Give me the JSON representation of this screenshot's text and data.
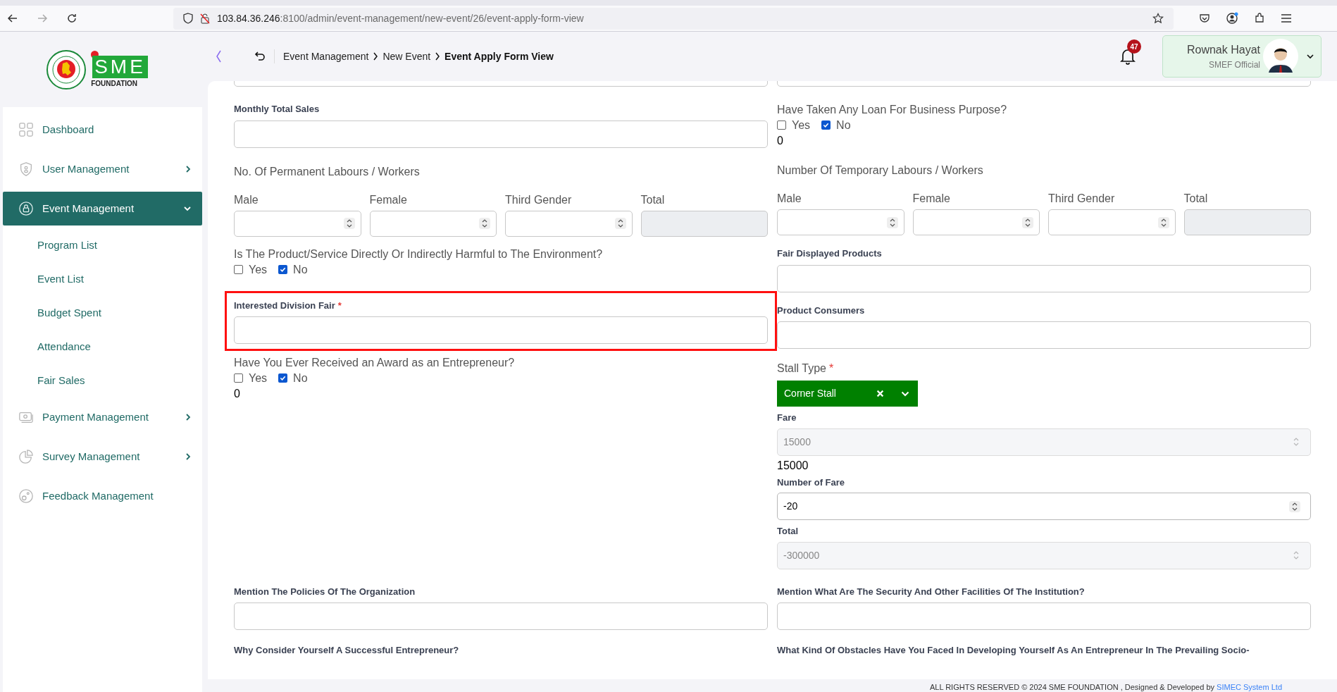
{
  "browser": {
    "url_host": "103.84.36.246",
    "url_path": ":8100/admin/event-management/new-event/26/event-apply-form-view"
  },
  "brand": {
    "name": "SME",
    "subtitle": "FOUNDATION"
  },
  "header": {
    "breadcrumbs": [
      {
        "label": "Event Management",
        "current": false
      },
      {
        "label": "New Event",
        "current": false
      },
      {
        "label": "Event Apply Form View",
        "current": true
      }
    ],
    "notification_count": "47",
    "user": {
      "name": "Rownak Hayat",
      "role": "SMEF Official"
    }
  },
  "sidebar": {
    "items": [
      {
        "label": "Dashboard",
        "selected": false
      },
      {
        "label": "User Management",
        "selected": false,
        "expanded": false
      },
      {
        "label": "Event Management",
        "selected": true,
        "expanded": true,
        "children": [
          {
            "label": "Program List",
            "selected": false
          },
          {
            "label": "Event List",
            "selected": false
          },
          {
            "label": "Budget Spent",
            "selected": false
          },
          {
            "label": "Attendance",
            "selected": false
          },
          {
            "label": "Fair Sales",
            "selected": false
          }
        ]
      },
      {
        "label": "Payment Management",
        "selected": false,
        "expanded": false
      },
      {
        "label": "Survey Management",
        "selected": false,
        "expanded": false
      },
      {
        "label": "Feedback Management",
        "selected": false
      }
    ]
  },
  "form": {
    "left": [
      {
        "kind": "text",
        "label": "Monthly Total Sales",
        "highlighted": false
      },
      {
        "kind": "labour",
        "heading": "No. Of Permanent Labours / Workers",
        "columns": [
          {
            "label": "Male",
            "disabled": false
          },
          {
            "label": "Female",
            "disabled": false
          },
          {
            "label": "Third Gender",
            "disabled": false
          },
          {
            "label": "Total",
            "disabled": true
          }
        ]
      },
      {
        "kind": "yes_no",
        "question": "Is The Product/Service Directly Or Indirectly Harmful to The Environment?",
        "options": [
          {
            "label": "Yes",
            "checked": false
          },
          {
            "label": "No",
            "checked": true
          }
        ]
      },
      {
        "kind": "text",
        "label": "Interested Division Fair",
        "required_mark": "*",
        "highlighted": true
      },
      {
        "kind": "yes_no",
        "question": "Have You Ever Received an Award as an Entrepreneur?",
        "options": [
          {
            "label": "Yes",
            "checked": false
          },
          {
            "label": "No",
            "checked": true
          }
        ],
        "result": "0"
      }
    ],
    "right": [
      {
        "kind": "yes_no",
        "question": "Have Taken Any Loan For Business Purpose?",
        "options": [
          {
            "label": "Yes",
            "checked": false
          },
          {
            "label": "No",
            "checked": true
          }
        ],
        "result": "0"
      },
      {
        "kind": "labour",
        "heading": "Number Of Temporary Labours / Workers",
        "columns": [
          {
            "label": "Male",
            "disabled": false
          },
          {
            "label": "Female",
            "disabled": false
          },
          {
            "label": "Third Gender",
            "disabled": false
          },
          {
            "label": "Total",
            "disabled": true
          }
        ]
      },
      {
        "kind": "text",
        "label": "Fair Displayed Products",
        "highlighted": false
      },
      {
        "kind": "text",
        "label": "Product Consumers",
        "highlighted": false
      },
      {
        "kind": "select",
        "label": "Stall Type",
        "required_mark": "*",
        "value": "Corner Stall"
      },
      {
        "kind": "number",
        "label": "Fare",
        "value": "15000",
        "disabled": true,
        "note": "15000"
      },
      {
        "kind": "number",
        "label": "Number of Fare",
        "value": "-20",
        "disabled": false
      },
      {
        "kind": "number",
        "label": "Total",
        "value": "-300000",
        "disabled": true
      }
    ],
    "bottom": [
      {
        "kind": "text",
        "label": "Mention The Policies Of The Organization",
        "highlighted": false
      },
      {
        "kind": "text",
        "label": "Mention What Are The Security And Other Facilities Of The Institution?",
        "highlighted": false
      },
      {
        "kind": "label",
        "label": "Why Consider Yourself A Successful Entrepreneur?"
      },
      {
        "kind": "label",
        "label": "What Kind Of Obstacles Have You Faced In Developing Yourself As An Entrepreneur In The Prevailing Socio-"
      }
    ]
  },
  "footer": {
    "text": "ALL RIGHTS RESERVED © 2024 SME FOUNDATION , Designed & Developed by",
    "link": "SIMEC System Ltd"
  }
}
